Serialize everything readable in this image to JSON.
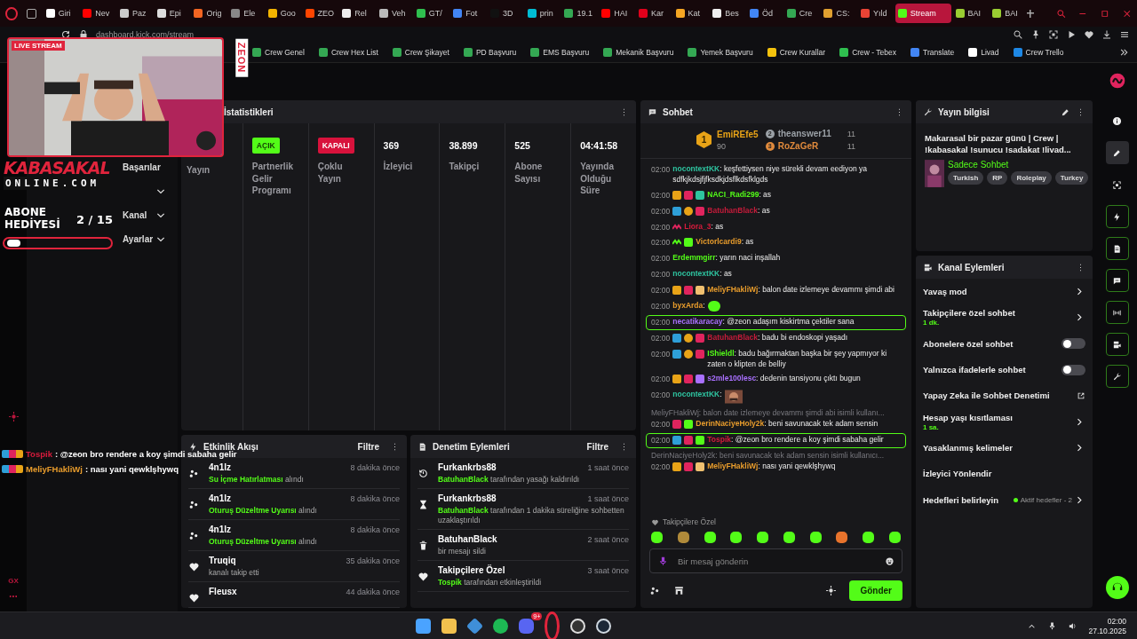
{
  "browser": {
    "tabs": [
      {
        "label": "Giri",
        "color": "#ffffff",
        "selected": false
      },
      {
        "label": "Nev",
        "color": "#ff0000",
        "selected": false
      },
      {
        "label": "Paz",
        "color": "#cccccc",
        "selected": false
      },
      {
        "label": "Epi",
        "color": "#dddddd",
        "selected": false
      },
      {
        "label": "Orig",
        "color": "#f26522",
        "selected": false
      },
      {
        "label": "Ele",
        "color": "#888888",
        "selected": false
      },
      {
        "label": "Goo",
        "color": "#f4b400",
        "selected": false
      },
      {
        "label": "ZEO",
        "color": "#ff4500",
        "selected": false
      },
      {
        "label": "Rel",
        "color": "#eeeeee",
        "selected": false
      },
      {
        "label": "Veh",
        "color": "#bbbbbb",
        "selected": false
      },
      {
        "label": "GT/",
        "color": "#2fbf4f",
        "selected": false
      },
      {
        "label": "Fot",
        "color": "#4285f4",
        "selected": false
      },
      {
        "label": "3D",
        "color": "#111111",
        "selected": false
      },
      {
        "label": "prin",
        "color": "#00bcd4",
        "selected": false
      },
      {
        "label": "19.1",
        "color": "#34a853",
        "selected": false
      },
      {
        "label": "HAI",
        "color": "#ff0000",
        "selected": false
      },
      {
        "label": "Kar",
        "color": "#e0001b",
        "selected": false
      },
      {
        "label": "Kat",
        "color": "#f5a623",
        "selected": false
      },
      {
        "label": "Bes",
        "color": "#f0f0f0",
        "selected": false
      },
      {
        "label": "Öd",
        "color": "#4285f4",
        "selected": false
      },
      {
        "label": "Cre",
        "color": "#34a853",
        "selected": false
      },
      {
        "label": "CS:",
        "color": "#e0a030",
        "selected": false
      },
      {
        "label": "Yıld",
        "color": "#ea4335",
        "selected": false
      },
      {
        "label": "Stream",
        "color": "#53fc18",
        "selected": true
      },
      {
        "label": "BAI",
        "color": "#9acd32",
        "selected": false
      },
      {
        "label": "BAI",
        "color": "#9acd32",
        "selected": false
      }
    ],
    "address": "dashboard.kick.com/stream",
    "bookmarks": [
      {
        "label": "Crew Genel",
        "color": "#34a853"
      },
      {
        "label": "Crew Hex List",
        "color": "#34a853"
      },
      {
        "label": "Crew Şikayet",
        "color": "#34a853"
      },
      {
        "label": "PD Başvuru",
        "color": "#34a853"
      },
      {
        "label": "EMS Başvuru",
        "color": "#34a853"
      },
      {
        "label": "Mekanik Başvuru",
        "color": "#34a853"
      },
      {
        "label": "Yemek Başvuru",
        "color": "#34a853"
      },
      {
        "label": "Crew Kurallar",
        "color": "#f4c20d"
      },
      {
        "label": "Crew - Tebex",
        "color": "#2fbf4f"
      },
      {
        "label": "Translate",
        "color": "#4285f4"
      },
      {
        "label": "Livad",
        "color": "#ffffff"
      },
      {
        "label": "Crew Trello",
        "color": "#1e88e5"
      }
    ]
  },
  "overlay": {
    "live_label": "LIVE STREAM",
    "brand": "ZEON",
    "logo_top": "KABASAKAL",
    "logo_bottom": "ONLINE.COM",
    "gift_line_1": "ABONE",
    "gift_line_2": "HEDİYESİ",
    "gift_count": "2 / 15",
    "goal_bar": {
      "level": 0.13
    },
    "chat": [
      {
        "user": "Tospik",
        "color": "#d81b3c",
        "text": ": @zeon bro rendere a koy şimdi sabaha gelir"
      },
      {
        "user": "MeliyFHakliWj",
        "color": "#e89c2c",
        "text": ": nası yani qewklşhywq"
      }
    ]
  },
  "sidebar": {
    "items": [
      {
        "kind": "plain",
        "label": "Başarılar"
      },
      {
        "kind": "expand",
        "expanded": false
      },
      {
        "kind": "expand",
        "label": "Kanal",
        "expanded": false
      },
      {
        "kind": "expand",
        "label": "Ayarlar",
        "expanded": false
      }
    ],
    "footer": "GX"
  },
  "stats": {
    "title": "İstatistikleri",
    "items": [
      {
        "kind": "plain",
        "label": "Yayın"
      },
      {
        "kind": "status",
        "on": true,
        "badge": "AÇIK",
        "label": "Partnerlik Gelir Programı"
      },
      {
        "kind": "status",
        "on": false,
        "badge": "KAPALI",
        "label": "Çoklu Yayın"
      },
      {
        "kind": "number",
        "value": "369",
        "label": "İzleyici"
      },
      {
        "kind": "number",
        "value": "38.899",
        "label": "Takipçi"
      },
      {
        "kind": "number",
        "value": "525",
        "label": "Abone Sayısı"
      },
      {
        "kind": "number",
        "value": "04:41:58",
        "label": "Yayında Olduğu Süre"
      }
    ]
  },
  "activity": {
    "title": "Etkinlik Akışı",
    "filter": "Filtre",
    "items": [
      {
        "kind": "points",
        "user": "4n1lz",
        "time": "8 dakika önce",
        "highlight": "Su İçme Hatırlatması",
        "text": " alındı"
      },
      {
        "kind": "points",
        "user": "4n1lz",
        "time": "8 dakika önce",
        "highlight": "Oturuş Düzeltme Uyarısı",
        "text": " alındı"
      },
      {
        "kind": "points",
        "user": "4n1lz",
        "time": "8 dakika önce",
        "highlight": "Oturuş Düzeltme Uyarısı",
        "text": " alındı"
      },
      {
        "kind": "follow",
        "user": "Truqiq",
        "time": "35 dakika önce",
        "text": "kanalı takip etti"
      },
      {
        "kind": "follow",
        "user": "Fleusx",
        "time": "44 dakika önce"
      }
    ]
  },
  "moderation": {
    "title": "Denetim Eylemleri",
    "filter": "Filtre",
    "items": [
      {
        "kind": "unban",
        "user": "Furkankrbs88",
        "time": "1 saat önce",
        "highlight": "BatuhanBlack",
        "text": " tarafından yasağı kaldırıldı"
      },
      {
        "kind": "timeout",
        "user": "Furkankrbs88",
        "time": "1 saat önce",
        "highlight": "BatuhanBlack",
        "text": " tarafından 1 dakika süreliğine sohbetten uzaklaştırıldı"
      },
      {
        "kind": "delete",
        "user": "BatuhanBlack",
        "time": "2 saat önce",
        "text": "bir mesajı sildi"
      },
      {
        "kind": "follow",
        "user": "Takipçilere Özel",
        "time": "3 saat önce",
        "highlight": "Tospik",
        "text": " tarafından etkinleştirildi"
      }
    ]
  },
  "chat": {
    "title": "Sohbet",
    "leaders": [
      {
        "rank": "1",
        "name": "EmiREfe5",
        "count": "90",
        "color": "#e8a317"
      },
      {
        "rank": "2",
        "name": "theanswer11",
        "count": "11",
        "color": "#9aa0a6"
      },
      {
        "rank": "3",
        "name": "RoZaGeR",
        "count": "11",
        "color": "#e08a3c"
      }
    ],
    "messages": [
      {
        "kind": "text",
        "time": "02:00",
        "user": "nocontextKK",
        "color": "#2ec4a0",
        "text": ": keşfettiysen niye sürekli devam eediyon ya sdfkjkdsjfjfksdkjdsflkdsfklgds",
        "highlighted": false
      },
      {
        "kind": "text",
        "time": "02:00",
        "user": "NACI_Radi299",
        "color": "#53fc18",
        "badges": [
          {
            "kind": "crown"
          },
          {
            "kind": "kick"
          },
          {
            "kind": "gift",
            "color": "#2ec4a0"
          }
        ],
        "text": ": as",
        "highlighted": false
      },
      {
        "kind": "text",
        "time": "02:00",
        "user": "BatuhanBlack",
        "color": "#c41b3a",
        "badges": [
          {
            "kind": "mod"
          },
          {
            "kind": "sub"
          },
          {
            "kind": "kick"
          }
        ],
        "text": ": as",
        "highlighted": false
      },
      {
        "kind": "text",
        "time": "02:00",
        "user": "Liora_3",
        "color": "#d81b3c",
        "badges": [
          {
            "kind": "wave",
            "color": "#e0245e"
          }
        ],
        "text": ": as",
        "highlighted": false
      },
      {
        "kind": "text",
        "time": "02:00",
        "user": "Victorlcardi9",
        "color": "#e89c2c",
        "badges": [
          {
            "kind": "wave",
            "color": "#53fc18"
          },
          {
            "kind": "gift",
            "color": "#53fc18"
          }
        ],
        "text": ": as",
        "highlighted": false
      },
      {
        "kind": "text",
        "time": "02:00",
        "user": "Erdemmgirr",
        "color": "#53fc18",
        "text": ": yarın naci inşallah",
        "highlighted": false
      },
      {
        "kind": "text",
        "time": "02:00",
        "user": "nocontextKK",
        "color": "#2ec4a0",
        "text": ": as",
        "highlighted": false
      },
      {
        "kind": "text",
        "time": "02:00",
        "user": "MeliyFHakliWj",
        "color": "#e89c2c",
        "badges": [
          {
            "kind": "crown"
          },
          {
            "kind": "kick"
          },
          {
            "kind": "gift",
            "color": "#f0c070"
          }
        ],
        "text": ": balon date izlemeye devammı şimdi abi",
        "highlighted": false
      },
      {
        "kind": "emote",
        "time": "02:00",
        "user": "byxArda",
        "color": "#e89c2c",
        "text": ":",
        "highlighted": false
      },
      {
        "kind": "text",
        "time": "02:00",
        "user": "necatikaracay",
        "color": "#a970ff",
        "text": ": @zeon adaşım kiskirtma çektiler sana",
        "highlighted": true
      },
      {
        "kind": "text",
        "time": "02:00",
        "user": "BatuhanBlack",
        "color": "#c41b3a",
        "badges": [
          {
            "kind": "mod"
          },
          {
            "kind": "sub"
          },
          {
            "kind": "kick"
          }
        ],
        "text": ": badu bi endoskopi yaşadı",
        "highlighted": false
      },
      {
        "kind": "text",
        "time": "02:00",
        "user": "IShieldl",
        "color": "#53fc18",
        "badges": [
          {
            "kind": "mod"
          },
          {
            "kind": "sub"
          },
          {
            "kind": "kick"
          }
        ],
        "text": ": badu bağırmaktan başka bir şey yapmıyor ki zaten o klipten de belliy",
        "highlighted": false
      },
      {
        "kind": "text",
        "time": "02:00",
        "user": "s2mle100lesc",
        "color": "#a970ff",
        "badges": [
          {
            "kind": "crown"
          },
          {
            "kind": "kick"
          },
          {
            "kind": "gift",
            "color": "#a970ff"
          }
        ],
        "text": ": dedenin tansiyonu çıktı bugun",
        "highlighted": false
      },
      {
        "time": "02:00",
        "user": "nocontextKK",
        "color": "#2ec4a0",
        "text": ":",
        "highlighted": false
      },
      {
        "kind": "text",
        "time": "02:00",
        "reply": "MeliyFHakliWj: balon date izlemeye devammı şimdi abi isimli kullanı...",
        "user": "DerinNaciyeHoly2k",
        "color": "#e89c2c",
        "badges": [
          {
            "kind": "kick"
          },
          {
            "kind": "gift",
            "color": "#53fc18"
          }
        ],
        "text": ": beni savunacak tek adam sensin",
        "highlighted": false
      },
      {
        "kind": "text",
        "time": "02:00",
        "user": "Tospik",
        "color": "#d81b3c",
        "badges": [
          {
            "kind": "mod"
          },
          {
            "kind": "kick"
          },
          {
            "kind": "gift",
            "color": "#53fc18"
          }
        ],
        "text": ": @zeon bro rendere a koy şimdi sabaha gelir",
        "highlighted": true
      },
      {
        "kind": "text",
        "time": "02:00",
        "reply": "DerinNaciyeHoly2k: beni savunacak tek adam sensin isimli kullanıcı...",
        "user": "MeliyFHakliWj",
        "color": "#e89c2c",
        "badges": [
          {
            "kind": "crown"
          },
          {
            "kind": "kick"
          },
          {
            "kind": "gift",
            "color": "#f0c070"
          }
        ],
        "text": ": nası yani qewklşhywq",
        "highlighted": false
      }
    ],
    "emote_section": "Takipçilere Özel",
    "emotes": [
      {
        "color": "#53fc18"
      },
      {
        "color": "#b08a3a"
      },
      {
        "color": "#53fc18"
      },
      {
        "color": "#53fc18"
      },
      {
        "color": "#53fc18"
      },
      {
        "color": "#53fc18"
      },
      {
        "color": "#53fc18"
      },
      {
        "color": "#e8732c"
      },
      {
        "color": "#53fc18"
      },
      {
        "color": "#53fc18"
      }
    ],
    "input": {
      "placeholder": "Bir mesaj gönderin"
    },
    "send": "Gönder"
  },
  "stream_info": {
    "title": "Yayın bilgisi",
    "stream_title": "Makarasal bir pazar günü | Crew | !kabasakal !sunucu !sadakat !livad...",
    "category": "Sadece Sohbet",
    "tags": [
      "Turkish",
      "RP",
      "Roleplay",
      "Turkey"
    ]
  },
  "channel_actions": {
    "title": "Kanal Eylemleri",
    "items": [
      {
        "kind": "arrow",
        "label": "Yavaş mod"
      },
      {
        "kind": "arrow",
        "label": "Takipçilere özel sohbet",
        "value": "1 dk."
      },
      {
        "kind": "toggle",
        "label": "Abonelere özel sohbet",
        "on": false
      },
      {
        "kind": "toggle",
        "label": "Yalnızca ifadelerle sohbet",
        "on": false
      },
      {
        "kind": "external",
        "label": "Yapay Zeka ile Sohbet Denetimi"
      },
      {
        "kind": "arrow",
        "label": "Hesap yaşı kısıtlaması",
        "value": "1 sa."
      },
      {
        "kind": "arrow",
        "label": "Yasaklanmış kelimeler"
      },
      {
        "kind": "plain",
        "label": "İzleyici Yönlendir"
      },
      {
        "kind": "arrow",
        "label": "Hedefleri belirleyin",
        "status": "Aktif hedefler - 2"
      }
    ]
  },
  "rail": [
    {
      "selected": false
    },
    {
      "selected": true
    },
    {
      "selected": false
    },
    {
      "selected": false
    },
    {
      "selected": false
    },
    {
      "selected": false
    },
    {
      "selected": false
    },
    {
      "selected": false
    },
    {
      "selected": false
    }
  ],
  "taskbar": {
    "chat_badge": "9+",
    "time": "02:00",
    "date": "27.10.2025"
  }
}
